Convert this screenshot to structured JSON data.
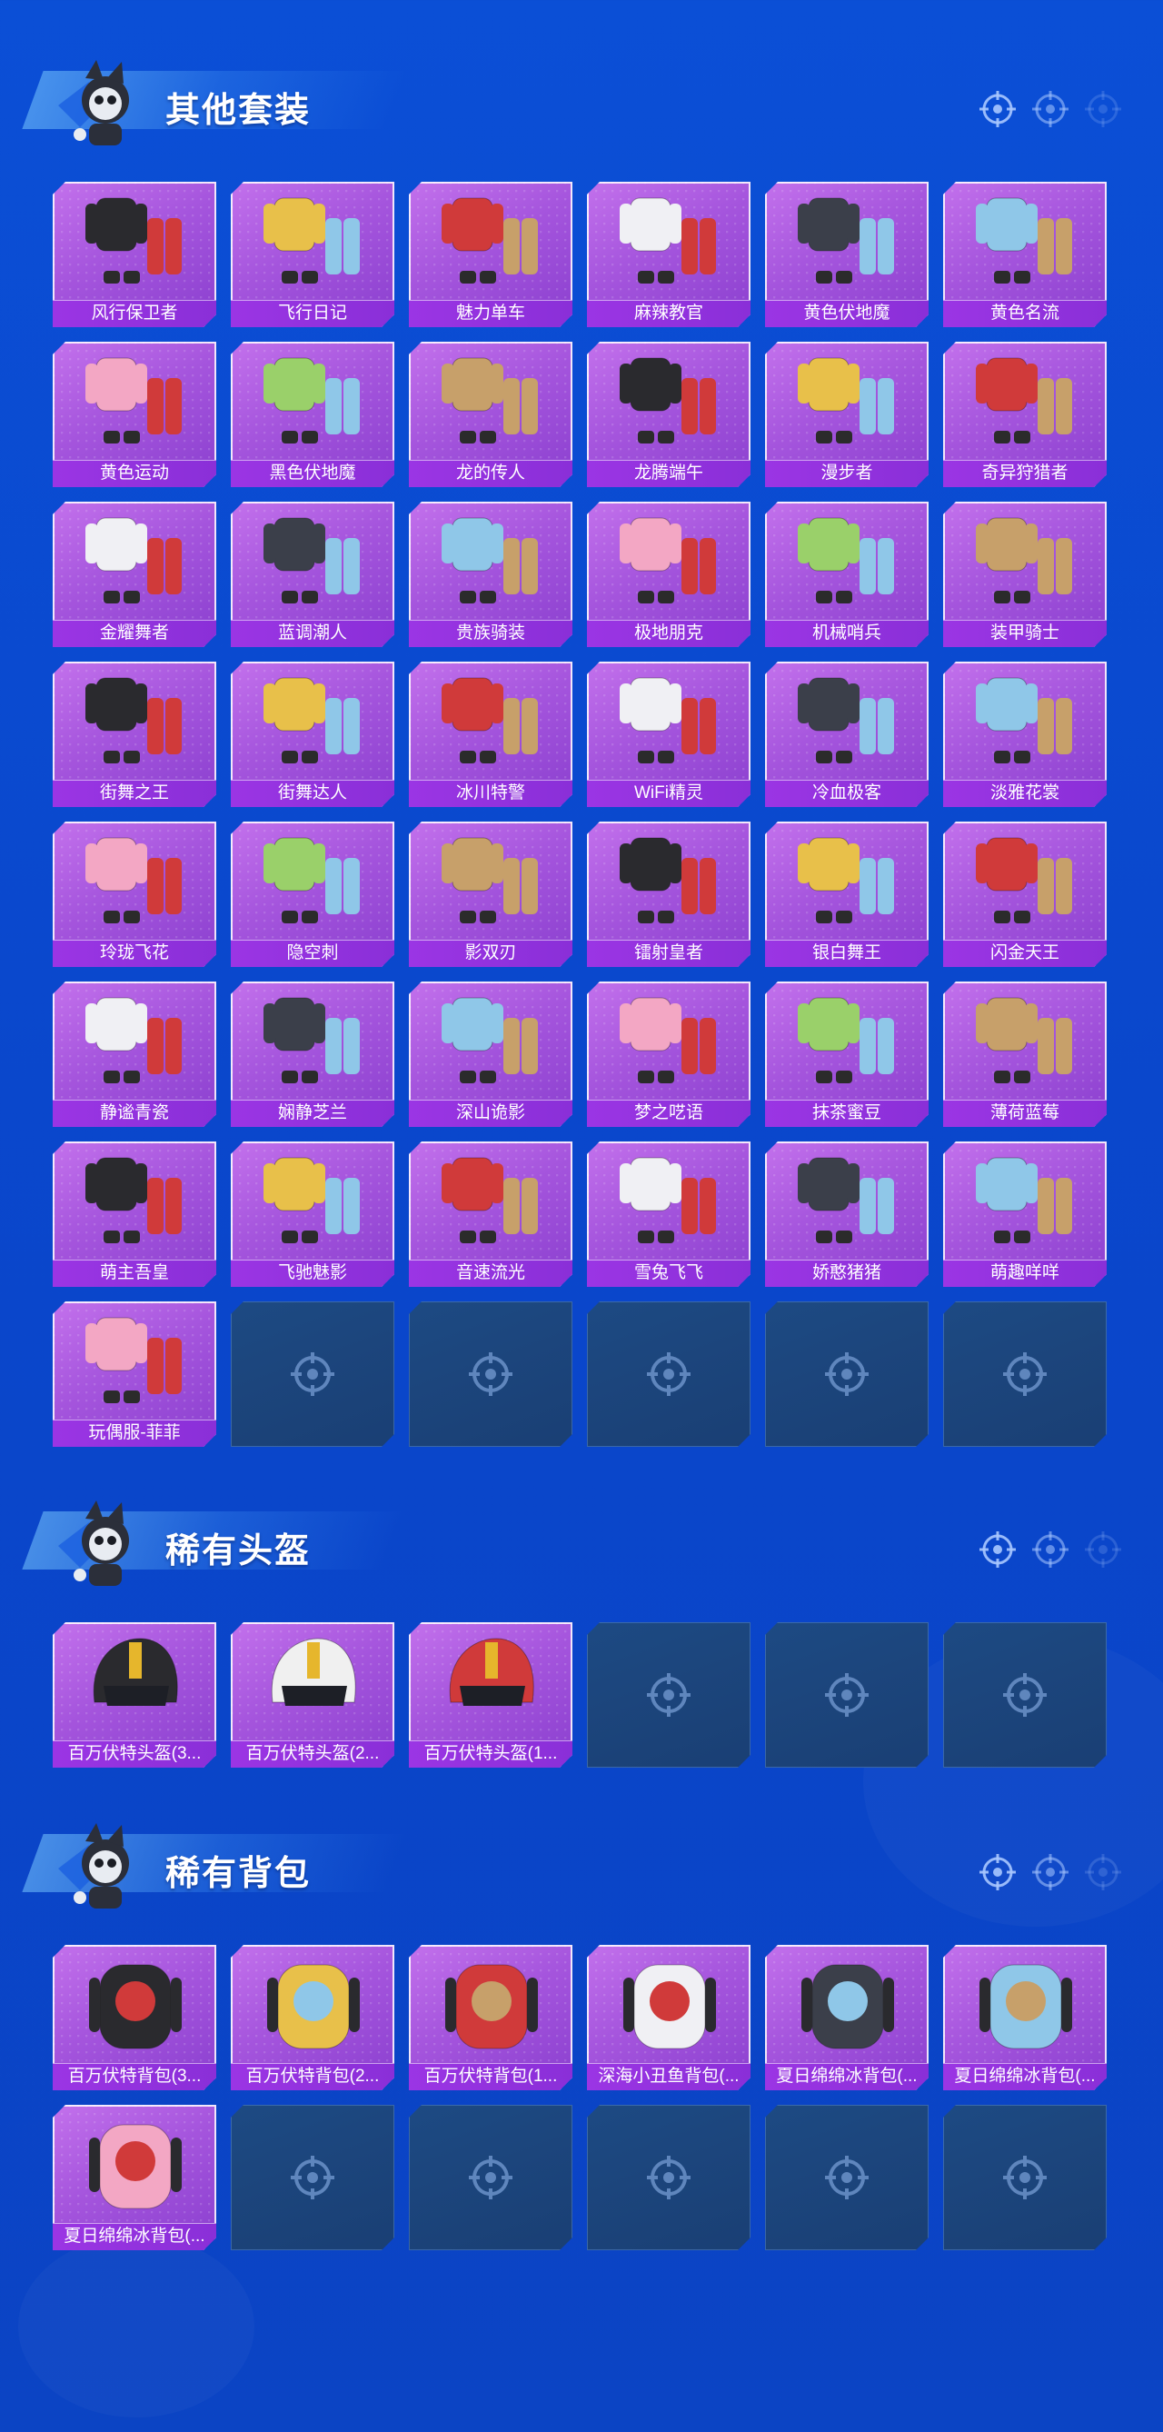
{
  "sections": [
    {
      "id": "outfits",
      "title": "其他套装",
      "items": [
        "风行保卫者",
        "飞行日记",
        "魅力单车",
        "麻辣教官",
        "黄色伏地魔",
        "黄色名流",
        "黄色运动",
        "黑色伏地魔",
        "龙的传人",
        "龙腾端午",
        "漫步者",
        "奇异狩猎者",
        "金耀舞者",
        "蓝调潮人",
        "贵族骑装",
        "极地朋克",
        "机械哨兵",
        "装甲骑士",
        "街舞之王",
        "街舞达人",
        "冰川特警",
        "WiFi精灵",
        "冷血极客",
        "淡雅花裳",
        "玲珑飞花",
        "隐空刺",
        "影双刃",
        "镭射皇者",
        "银白舞王",
        "闪金天王",
        "静谧青瓷",
        "娴静芝兰",
        "深山诡影",
        "梦之呓语",
        "抹茶蜜豆",
        "薄荷蓝莓",
        "萌主吾皇",
        "飞驰魅影",
        "音速流光",
        "雪兔飞飞",
        "娇憨猪猪",
        "萌趣咩咩",
        "玩偶服-菲菲"
      ],
      "empty_slots": 5
    },
    {
      "id": "helmets",
      "title": "稀有头盔",
      "items": [
        "百万伏特头盔(3...",
        "百万伏特头盔(2...",
        "百万伏特头盔(1..."
      ],
      "empty_slots": 3
    },
    {
      "id": "backpacks",
      "title": "稀有背包",
      "items": [
        "百万伏特背包(3...",
        "百万伏特背包(2...",
        "百万伏特背包(1...",
        "深海小丑鱼背包(...",
        "夏日绵绵冰背包(...",
        "夏日绵绵冰背包(...",
        "夏日绵绵冰背包(..."
      ],
      "empty_slots": 5
    }
  ],
  "icons": {
    "header_mascot": "mascot-icon",
    "header_decor": "crosshair-icon",
    "empty_slot": "crosshair-icon"
  },
  "colors": {
    "background": "#0b4fd6",
    "card_purple": "#a555dd",
    "label_purple": "#9b35e4",
    "empty_slot": "#1d4a83"
  }
}
